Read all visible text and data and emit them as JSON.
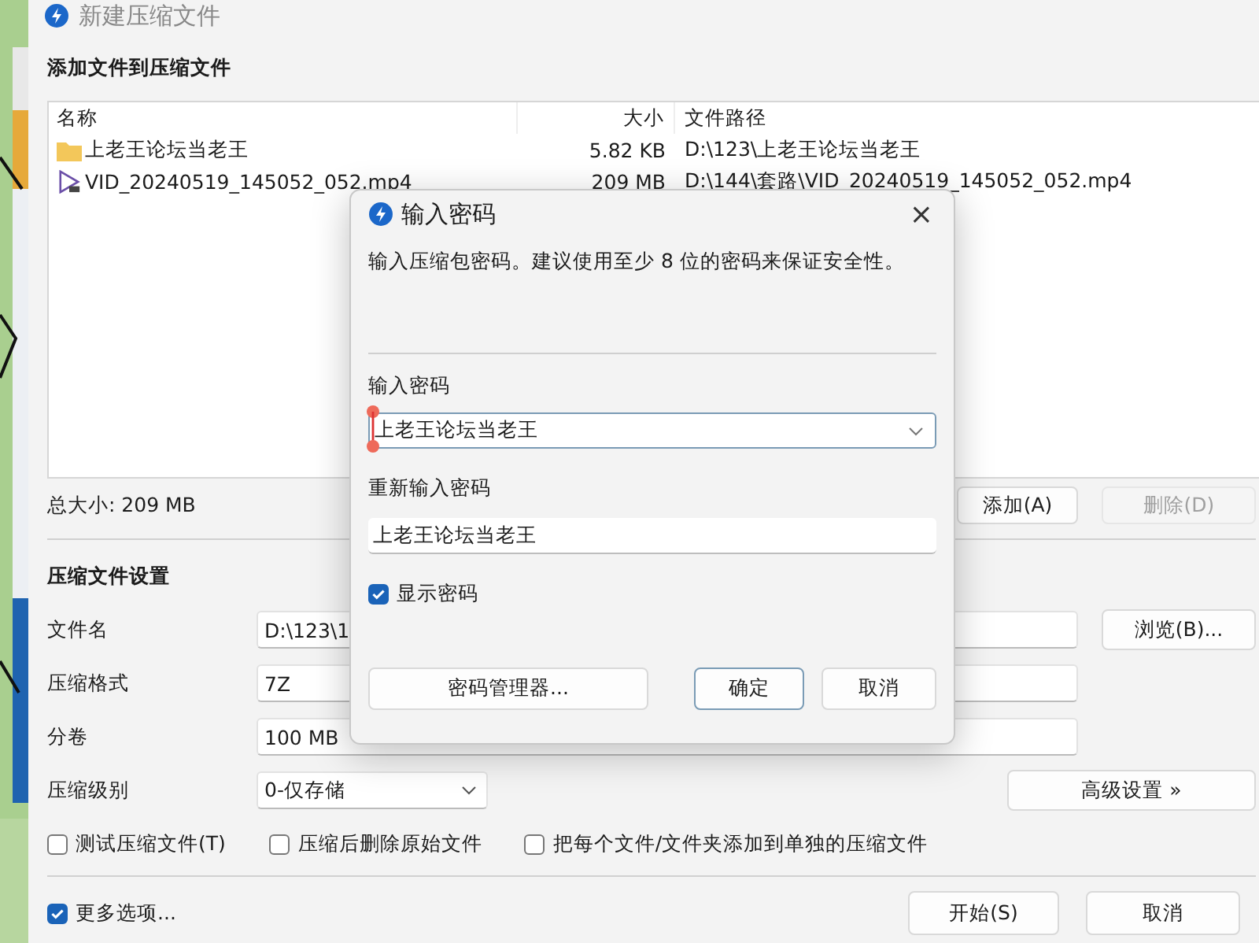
{
  "window": {
    "title": "新建压缩文件"
  },
  "files": {
    "heading": "添加文件到压缩文件",
    "columns": [
      "名称",
      "大小",
      "文件路径"
    ],
    "rows": [
      {
        "kind": "folder",
        "name": "上老王论坛当老王",
        "size": "5.82 KB",
        "path": "D:\\123\\上老王论坛当老王"
      },
      {
        "kind": "video",
        "name": "VID_20240519_145052_052.mp4",
        "size": "209 MB",
        "path": "D:\\144\\套路\\VID_20240519_145052_052.mp4"
      }
    ]
  },
  "total_size": "总大小: 209 MB",
  "file_buttons": [
    {
      "label": "添加(A)",
      "disabled": false
    },
    {
      "label": "删除(D)",
      "disabled": true
    }
  ],
  "settings": {
    "heading": "压缩文件设置",
    "rows": [
      {
        "label": "文件名",
        "kind": "text",
        "value": "D:\\123\\1",
        "button": "浏览(B)..."
      },
      {
        "label": "压缩格式",
        "kind": "text",
        "value": "7Z"
      },
      {
        "label": "分卷",
        "kind": "text",
        "value": "100 MB"
      },
      {
        "label": "压缩级别",
        "kind": "dropdown",
        "value": "0-仅存储",
        "button": "高级设置 »"
      }
    ],
    "options": [
      {
        "label": "测试压缩文件(T)",
        "checked": false
      },
      {
        "label": "压缩后删除原始文件",
        "checked": false
      },
      {
        "label": "把每个文件/文件夹添加到单独的压缩文件",
        "checked": false
      }
    ]
  },
  "more_options": {
    "label": "更多选项...",
    "checked": true
  },
  "buttons": [
    {
      "label": "开始(S)"
    },
    {
      "label": "取消"
    }
  ],
  "dialog": {
    "title": "输入密码",
    "close": "×",
    "description": "输入压缩包密码。建议使用至少 8 位的密码来保证安全性。",
    "password_label": "输入密码",
    "password": "上老王论坛当老王",
    "confirm_label": "重新输入密码",
    "confirm": "上老王论坛当老王",
    "show_password": {
      "label": "显示密码",
      "checked": true
    },
    "buttons": [
      {
        "label": "密码管理器...",
        "default": false
      },
      {
        "label": "确定",
        "default": true
      },
      {
        "label": "取消",
        "default": false
      }
    ]
  }
}
